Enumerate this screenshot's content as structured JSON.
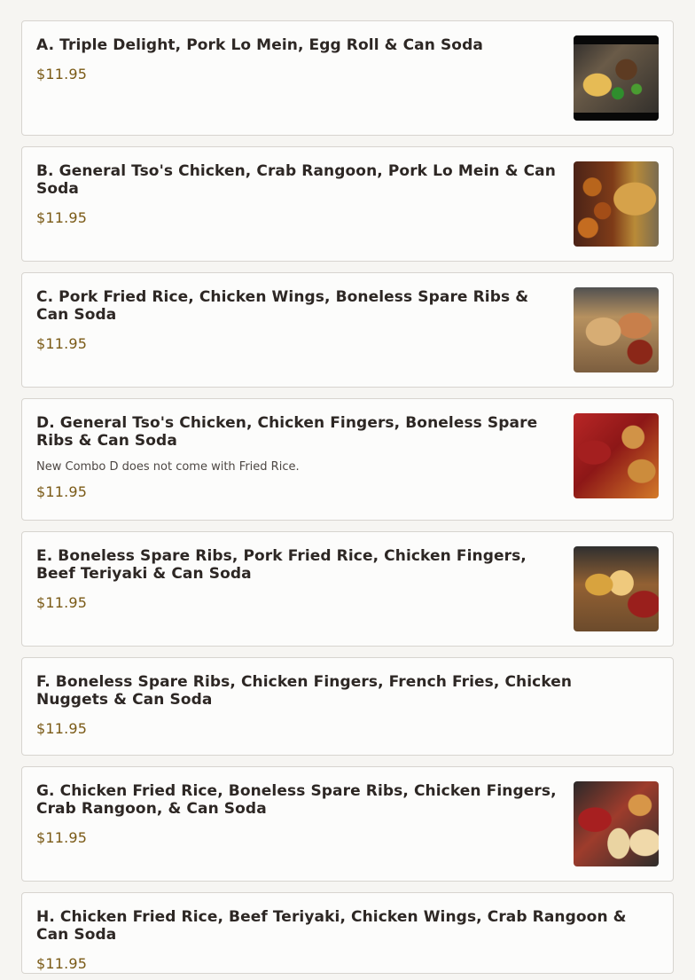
{
  "menu": {
    "items": [
      {
        "name": "A. Triple Delight, Pork Lo Mein, Egg Roll & Can Soda",
        "price": "$11.95",
        "image": "food-photo"
      },
      {
        "name": "B. General Tso's Chicken, Crab Rangoon, Pork Lo Mein & Can Soda",
        "price": "$11.95",
        "image": "food-photo"
      },
      {
        "name": "C. Pork Fried Rice, Chicken Wings, Boneless Spare Ribs & Can Soda",
        "price": "$11.95",
        "image": "food-photo"
      },
      {
        "name": "D. General Tso's Chicken, Chicken Fingers, Boneless Spare Ribs & Can Soda",
        "note": "New Combo D does not come with Fried Rice.",
        "price": "$11.95",
        "image": "food-photo"
      },
      {
        "name": "E. Boneless Spare Ribs, Pork Fried Rice, Chicken Fingers, Beef Teriyaki & Can Soda",
        "price": "$11.95",
        "image": "food-photo"
      },
      {
        "name": "F. Boneless Spare Ribs, Chicken Fingers, French Fries, Chicken Nuggets & Can Soda",
        "price": "$11.95"
      },
      {
        "name": "G. Chicken Fried Rice, Boneless Spare Ribs, Chicken Fingers, Crab Rangoon, & Can Soda",
        "price": "$11.95",
        "image": "food-photo"
      },
      {
        "name": "H. Chicken Fried Rice, Beef Teriyaki, Chicken Wings, Crab Rangoon & Can Soda",
        "price": "$11.95"
      }
    ]
  },
  "colors": {
    "background": "#f6f5f2",
    "card": "#fcfcfb",
    "border": "#d7d4cf",
    "price": "#7a5a16",
    "text": "#2d2724"
  }
}
